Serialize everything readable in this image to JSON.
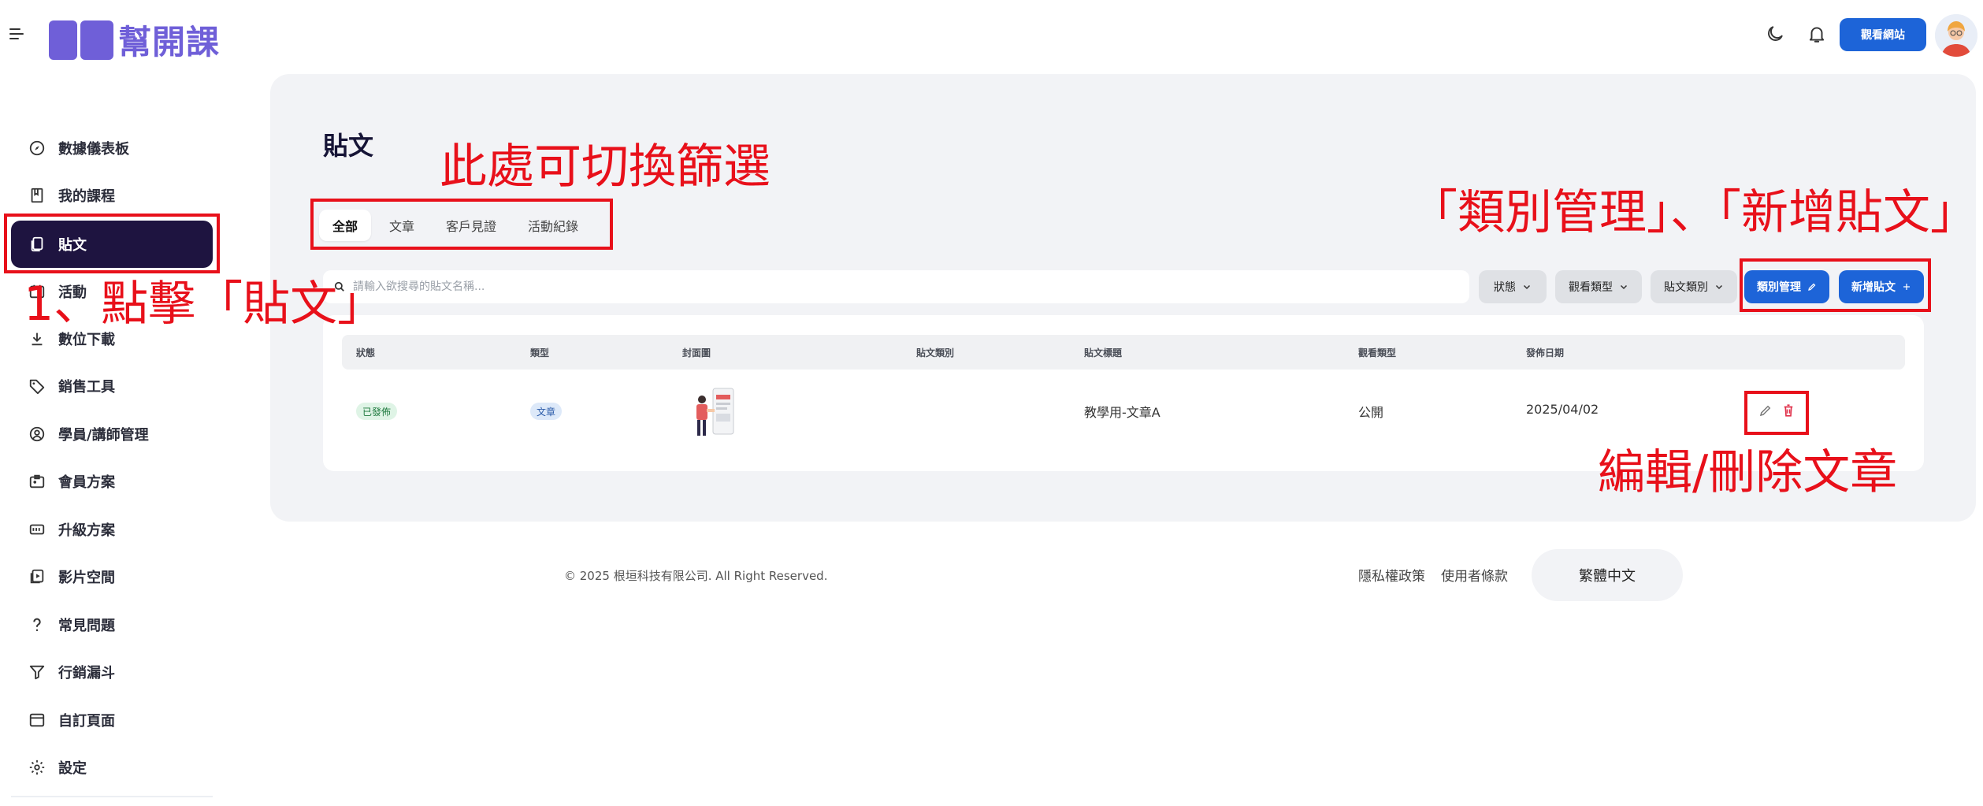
{
  "header": {
    "logo_text": "幫開課",
    "view_site_label": "觀看網站"
  },
  "sidebar": {
    "items": [
      {
        "label": "數據儀表板",
        "icon": "compass-icon"
      },
      {
        "label": "我的課程",
        "icon": "book-icon"
      },
      {
        "label": "貼文",
        "icon": "posts-icon"
      },
      {
        "label": "活動",
        "icon": "activity-icon"
      },
      {
        "label": "數位下載",
        "icon": "download-icon"
      },
      {
        "label": "銷售工具",
        "icon": "tag-icon"
      },
      {
        "label": "學員/講師管理",
        "icon": "user-circle-icon"
      },
      {
        "label": "會員方案",
        "icon": "id-card-icon"
      },
      {
        "label": "升級方案",
        "icon": "upgrade-icon"
      },
      {
        "label": "影片空間",
        "icon": "video-icon"
      },
      {
        "label": "常見問題",
        "icon": "question-icon"
      },
      {
        "label": "行銷漏斗",
        "icon": "funnel-icon"
      },
      {
        "label": "自訂頁面",
        "icon": "window-icon"
      },
      {
        "label": "設定",
        "icon": "gear-icon"
      }
    ]
  },
  "main": {
    "title": "貼文",
    "tabs": [
      {
        "label": "全部",
        "active": true
      },
      {
        "label": "文章",
        "active": false
      },
      {
        "label": "客戶見證",
        "active": false
      },
      {
        "label": "活動紀錄",
        "active": false
      }
    ],
    "search": {
      "placeholder": "請輸入欲搜尋的貼文名稱..."
    },
    "filters": {
      "status": "狀態",
      "view_type": "觀看類型",
      "post_category": "貼文類別"
    },
    "actions": {
      "category_manage": "類別管理",
      "new_post": "新增貼文"
    },
    "table": {
      "headers": [
        "狀態",
        "類型",
        "封面圖",
        "貼文類別",
        "貼文標題",
        "觀看類型",
        "發佈日期"
      ],
      "rows": [
        {
          "status": "已發佈",
          "type": "文章",
          "category": "",
          "title": "教學用-文章A",
          "view_type": "公開",
          "date": "2025/04/02"
        }
      ]
    }
  },
  "footer": {
    "copyright": "© 2025 根垣科技有限公司. All Right Reserved.",
    "privacy": "隱私權政策",
    "terms": "使用者條款",
    "language": "繁體中文"
  },
  "annotations": {
    "filter_note": "此處可切換篩選",
    "buttons_note": "「類別管理」、「新增貼文」",
    "click_note": "1、點擊「貼文」",
    "edit_note": "編輯/刪除文章",
    "color": "#e8101a"
  },
  "colors": {
    "brand": "#6f5fd8",
    "primary_button": "#1d64d8",
    "active_sidebar": "#1e1440",
    "panel_bg": "#f2f3f6"
  }
}
